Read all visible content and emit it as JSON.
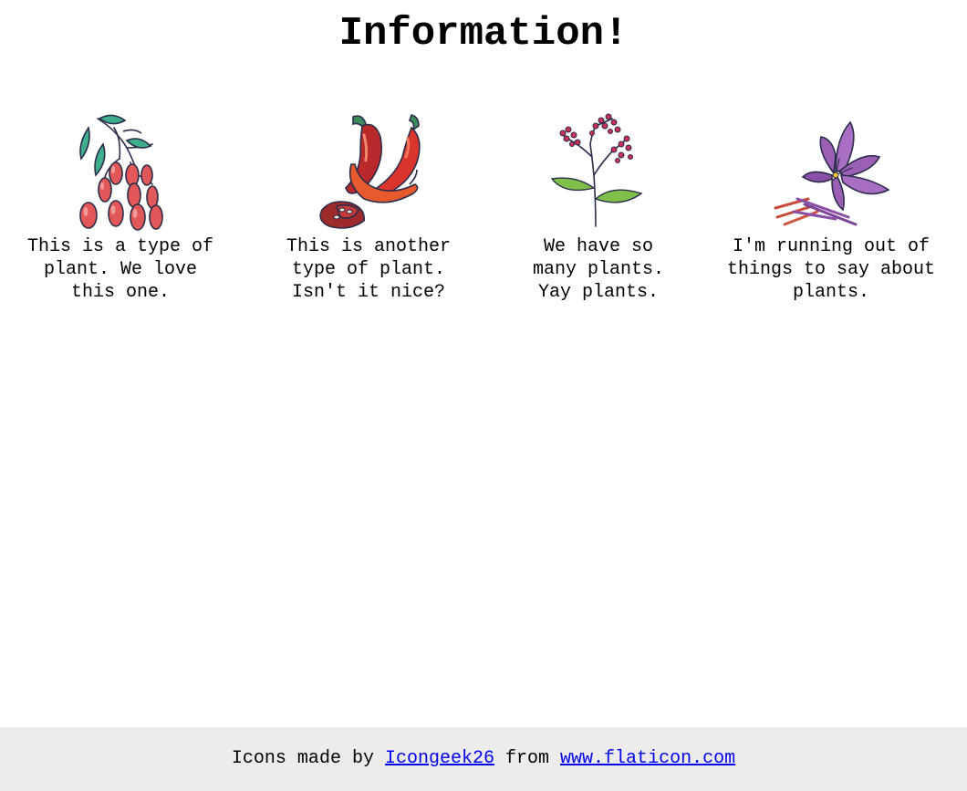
{
  "header": {
    "title": "Information!"
  },
  "cards": [
    {
      "icon": "goji-berries-icon",
      "caption_lines": [
        "This is a type of",
        "plant. We love",
        "this one."
      ]
    },
    {
      "icon": "chili-peppers-icon",
      "caption_lines": [
        "This is another",
        "type of plant.",
        "Isn't it nice?"
      ]
    },
    {
      "icon": "elderberry-plant-icon",
      "caption_lines": [
        "We have so",
        "many plants.",
        "Yay plants."
      ]
    },
    {
      "icon": "saffron-flower-icon",
      "caption_lines": [
        "I'm running out of",
        "things to say about",
        "plants."
      ]
    }
  ],
  "footer": {
    "prefix": "Icons made by",
    "author_link": "Icongeek26",
    "middle": "from",
    "site_link": "www.flaticon.com"
  },
  "colors": {
    "footer_background": "#ececec",
    "link": "#0000ee"
  }
}
